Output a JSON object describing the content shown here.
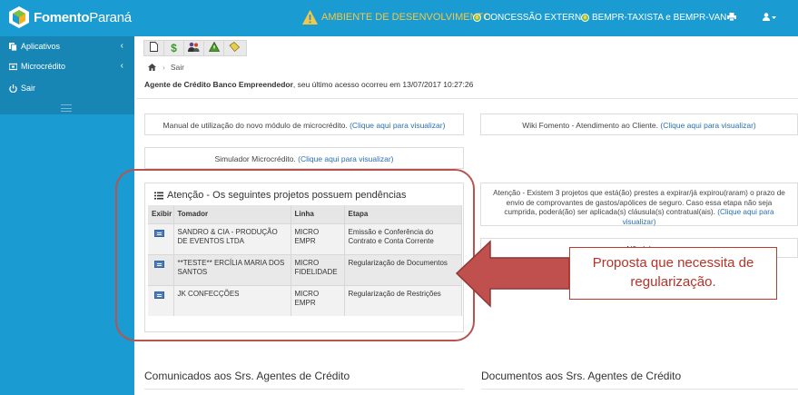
{
  "brand": {
    "name_bold": "Fomento",
    "name_light": "Paraná"
  },
  "header": {
    "env_warning": "AMBIENTE DE DESENVOLVIMENTO",
    "concession": "CONCESSÃO EXTERNA",
    "program": "BEMPR-TAXISTA e BEMPR-VAN",
    "print_icon": "print-icon",
    "user_icon": "user-icon"
  },
  "sidebar": {
    "items": [
      {
        "label": "Aplicativos",
        "icon": "apps-icon"
      },
      {
        "label": "Microcrédito",
        "icon": "card-icon"
      },
      {
        "label": "Sair",
        "icon": "power-icon"
      }
    ]
  },
  "breadcrumb": {
    "home_icon": "home-icon",
    "current": "Sair"
  },
  "welcome": {
    "agent": "Agente de Crédito Banco Empreendedor",
    "rest": ", seu último acesso ocorreu em 13/07/2017 10:27:26"
  },
  "cards": {
    "manual": {
      "text": "Manual de utilização do novo módulo de microcrédito. ",
      "link": "(Clique aqui para visualizar)"
    },
    "wiki": {
      "text": "Wiki Fomento - Atendimento ao Cliente. ",
      "link": "(Clique aqui para visualizar)"
    },
    "simulator": {
      "text": "Simulador Microcrédito. ",
      "link": "(Clique aqui para visualizar)"
    },
    "attention": {
      "text": "Atenção - Existem 3 projetos que está(ão) prestes a expirar/já expirou(raram) o prazo de envio de comprovantes de gastos/apólices de seguro. Caso essa etapa não seja cumprida, poderá(ão) ser aplicada(s) cláusula(s) contratual(ais). ",
      "link": "(Clique aqui para visualizar)"
    },
    "no_items": {
      "text": "Não há"
    }
  },
  "pendencies": {
    "title": "Atenção - Os seguintes projetos possuem pendências",
    "headers": [
      "Exibir",
      "Tomador",
      "Linha",
      "Etapa"
    ],
    "rows": [
      {
        "tomador": "SANDRO & CIA - PRODUÇÃO DE EVENTOS LTDA",
        "linha": "MICRO EMPR",
        "etapa": "Emissão e Conferência do Contrato e Conta Corrente"
      },
      {
        "tomador": "**TESTE** ERCÍLIA MARIA DOS SANTOS",
        "linha": "MICRO FIDELIDADE",
        "etapa": "Regularização de Documentos"
      },
      {
        "tomador": "JK CONFECÇÕES",
        "linha": "MICRO EMPR",
        "etapa": "Regularização de Restrições"
      }
    ]
  },
  "sections": {
    "left": "Comunicados aos Srs. Agentes de Crédito",
    "right": "Documentos aos Srs. Agentes de Crédito"
  },
  "annotation": {
    "callout": "Proposta que necessita de regularização."
  },
  "colors": {
    "header_blue": "#1a9bd1",
    "warning_yellow": "#f3c84a",
    "annotation_red": "#b83228",
    "link_blue": "#2a6fb0"
  }
}
